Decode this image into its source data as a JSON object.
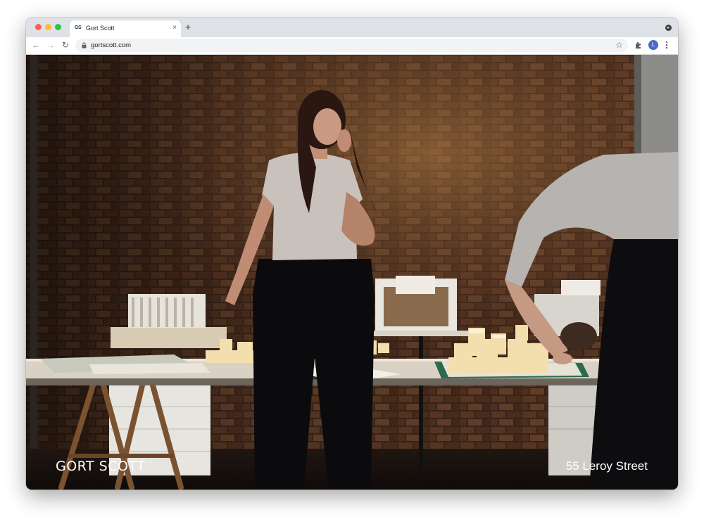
{
  "browser": {
    "tab": {
      "favicon_text": "GS",
      "title": "Gort Scott",
      "close_symbol": "×"
    },
    "new_tab_symbol": "+",
    "url": "gortscott.com",
    "profile_initial": "L",
    "icons": {
      "back": "back-arrow-icon",
      "forward": "forward-arrow-icon",
      "reload": "reload-icon",
      "lock": "lock-icon",
      "bookmark": "star-icon",
      "extensions": "puzzle-icon",
      "menu": "kebab-menu-icon"
    }
  },
  "page": {
    "logo_text": "GORT SCOTT",
    "project_title": "55 Leroy Street",
    "hero_image": "studio-architects-with-models-photo"
  },
  "colors": {
    "tab_strip": "#dee1e6",
    "traffic_red": "#ff5f57",
    "traffic_yellow": "#febc2e",
    "traffic_green": "#28c840",
    "avatar": "#4a67c9",
    "overlay_text": "#ffffff"
  }
}
